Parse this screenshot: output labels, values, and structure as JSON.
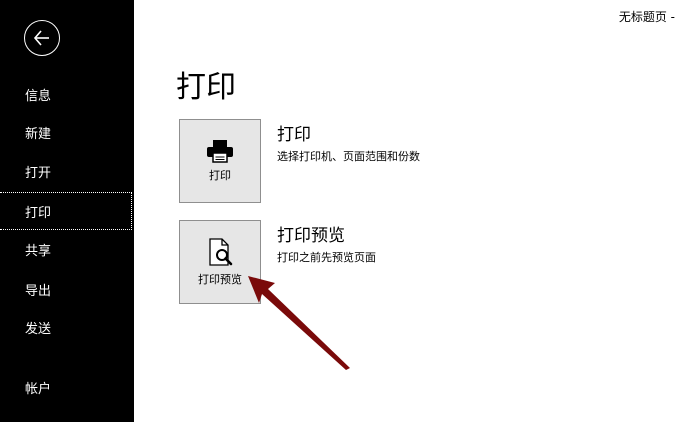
{
  "document": {
    "title": "无标题页 -"
  },
  "sidebar": {
    "back_icon": "back-arrow-icon",
    "items": [
      {
        "label": "信息"
      },
      {
        "label": "新建"
      },
      {
        "label": "打开"
      },
      {
        "label": "打印",
        "selected": true
      },
      {
        "label": "共享"
      },
      {
        "label": "导出"
      },
      {
        "label": "发送"
      },
      {
        "label": "帐户"
      }
    ]
  },
  "main": {
    "title": "打印",
    "options": [
      {
        "tile_label": "打印",
        "icon": "printer-icon",
        "title": "打印",
        "description": "选择打印机、页面范围和份数"
      },
      {
        "tile_label": "打印预览",
        "icon": "document-magnifier-icon",
        "title": "打印预览",
        "description": "打印之前先预览页面"
      }
    ]
  },
  "annotation": {
    "arrow_color": "#7a0a0a",
    "icon": "pointer-arrow"
  }
}
